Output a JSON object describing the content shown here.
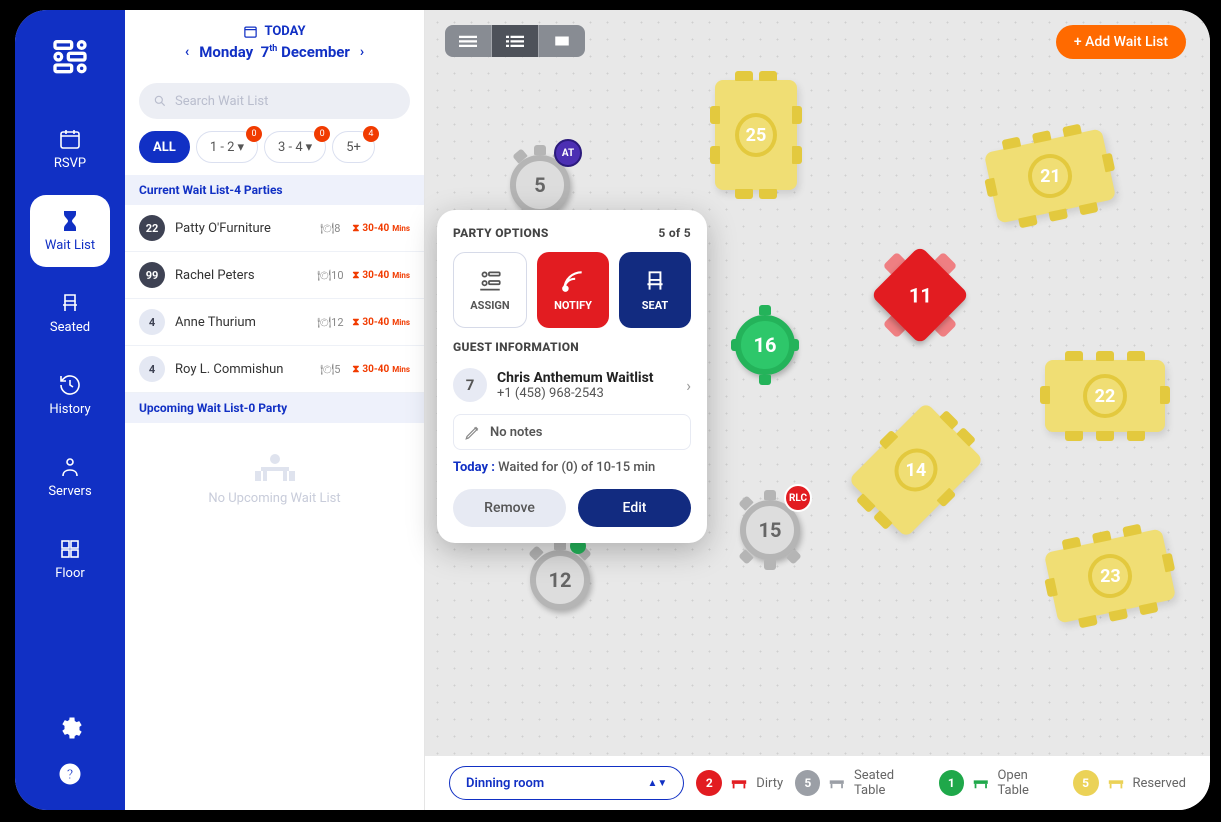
{
  "nav": {
    "rsvp": "RSVP",
    "waitlist": "Wait List",
    "seated": "Seated",
    "history": "History",
    "servers": "Servers",
    "floor": "Floor"
  },
  "header": {
    "today_label": "TODAY",
    "weekday": "Monday",
    "day": "7",
    "day_suffix": "th",
    "month": "December"
  },
  "search": {
    "placeholder": "Search Wait List"
  },
  "filters": {
    "all": "ALL",
    "f1": "1 - 2",
    "f1_badge": "0",
    "f2": "3 - 4",
    "f2_badge": "0",
    "f3": "5+",
    "f3_badge": "4"
  },
  "sections": {
    "current": "Current Wait List-4 Parties",
    "upcoming": "Upcoming  Wait List-0 Party",
    "empty": "No Upcoming Wait List"
  },
  "waitlist": [
    {
      "seats": "22",
      "name": "Patty O'Furniture",
      "table": "8",
      "wait": "30-40",
      "unit": "Mins"
    },
    {
      "seats": "99",
      "name": "Rachel Peters",
      "table": "10",
      "wait": "30-40",
      "unit": "Mins"
    },
    {
      "seats": "4",
      "name": "Anne Thurium",
      "table": "12",
      "wait": "30-40",
      "unit": "Mins"
    },
    {
      "seats": "4",
      "name": "Roy L. Commishun",
      "table": "5",
      "wait": "30-40",
      "unit": "Mins"
    }
  ],
  "popup": {
    "title": "PARTY OPTIONS",
    "count": "5 of 5",
    "assign": "ASSIGN",
    "notify": "NOTIFY",
    "seat": "SEAT",
    "guest_title": "GUEST INFORMATION",
    "guest_count": "7",
    "guest_name": "Chris Anthemum Waitlist",
    "guest_phone": "+1 (458) 968-2543",
    "no_notes": "No notes",
    "today_line_label": "Today :",
    "today_line_value": "Waited for (0) of 10-15 min",
    "remove": "Remove",
    "edit": "Edit"
  },
  "add_btn": "+ Add Wait List",
  "room_select": "Dinning room",
  "legend": {
    "dirty": {
      "count": "2",
      "label": "Dirty"
    },
    "seated": {
      "count": "5",
      "label": "Seated Table"
    },
    "open": {
      "count": "1",
      "label": "Open Table"
    },
    "reserved": {
      "count": "5",
      "label": "Reserved"
    }
  },
  "tables": {
    "t5": "5",
    "t12": "12",
    "t15": "15",
    "t16": "16",
    "t11": "11",
    "t25": "25",
    "t14": "14",
    "t21": "21",
    "t22": "22",
    "t23": "23",
    "pin_at": "AT",
    "pin_rlc": "RLC"
  }
}
